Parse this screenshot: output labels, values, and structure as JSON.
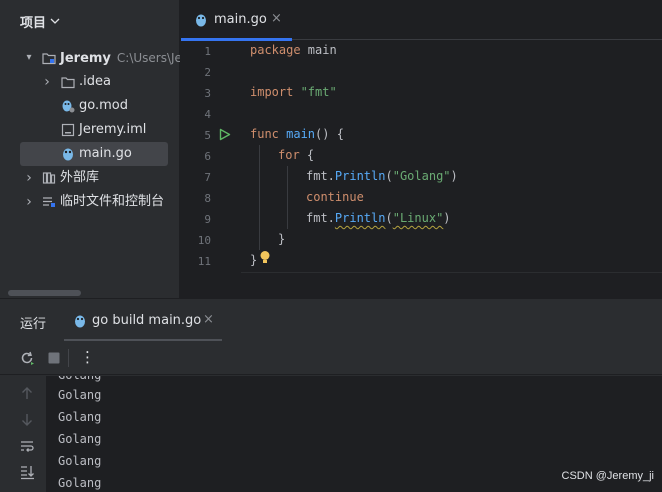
{
  "project": {
    "title": "项目",
    "tree": [
      {
        "label": "Jeremy",
        "path": "C:\\Users\\Jer",
        "arrow": "▾",
        "icon": "folder-module-icon"
      },
      {
        "label": ".idea",
        "arrow": "›",
        "icon": "folder-icon"
      },
      {
        "label": "go.mod",
        "icon": "gomod-file-icon"
      },
      {
        "label": "Jeremy.iml",
        "icon": "iml-file-icon"
      },
      {
        "label": "main.go",
        "icon": "go-file-icon",
        "selected": true
      },
      {
        "label": "外部库",
        "arrow": "›",
        "icon": "libraries-icon"
      },
      {
        "label": "临时文件和控制台",
        "arrow": "›",
        "icon": "scratches-icon"
      }
    ]
  },
  "editor": {
    "tab": {
      "label": "main.go",
      "close": "×"
    },
    "line_numbers": [
      "1",
      "2",
      "3",
      "4",
      "5",
      "6",
      "7",
      "8",
      "9",
      "10",
      "11"
    ],
    "code": {
      "l1_kw": "package",
      "l1_rest": " main",
      "l3_kw": "import",
      "l3_str": " \"fmt\"",
      "l5_kw": "func",
      "l5_fn": " main",
      "l5_rest": "() {",
      "l6_kw": "for",
      "l6_rest": " {",
      "l7_pkg": "fmt.",
      "l7_fn": "Println",
      "l7_p1": "(",
      "l7_str": "\"Golang\"",
      "l7_p2": ")",
      "l8_kw": "continue",
      "l9_pkg": "fmt.",
      "l9_fn": "Println",
      "l9_p1": "(",
      "l9_str": "\"Linux\"",
      "l9_p2": ")",
      "l10": "}",
      "l11": "}"
    }
  },
  "run": {
    "title": "运行",
    "tab_label": "go build main.go",
    "tab_close": "×",
    "more": "⋮",
    "output": [
      "Golang",
      "Golang",
      "Golang",
      "Golang",
      "Golang",
      "Golang"
    ]
  },
  "watermark": "CSDN @Jeremy_ji",
  "colors": {
    "accent": "#3574f0",
    "keyword": "#cf8e6d",
    "function": "#57aaf7",
    "string": "#6aab73",
    "run": "#5fb865"
  }
}
